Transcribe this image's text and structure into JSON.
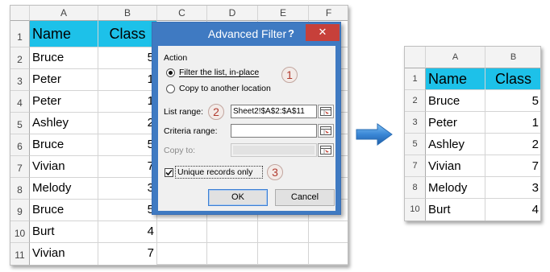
{
  "left_sheet": {
    "columns": [
      "A",
      "B",
      "C",
      "D",
      "E",
      "F"
    ],
    "rows": [
      "1",
      "2",
      "3",
      "4",
      "5",
      "6",
      "7",
      "8",
      "9",
      "10",
      "11"
    ],
    "header": {
      "name": "Name",
      "class": "Class"
    },
    "data": [
      {
        "name": "Bruce",
        "class": "5"
      },
      {
        "name": "Peter",
        "class": "1"
      },
      {
        "name": "Peter",
        "class": "1"
      },
      {
        "name": "Ashley",
        "class": "2"
      },
      {
        "name": "Bruce",
        "class": "5"
      },
      {
        "name": "Vivian",
        "class": "7"
      },
      {
        "name": "Melody",
        "class": "3"
      },
      {
        "name": "Bruce",
        "class": "5"
      },
      {
        "name": "Burt",
        "class": "4"
      },
      {
        "name": "Vivian",
        "class": "7"
      }
    ]
  },
  "dialog": {
    "title": "Advanced Filter",
    "help": "?",
    "close": "✕",
    "action_label": "Action",
    "filter_in_place": "Filter the list, in-place",
    "copy_to_location": "Copy to another location",
    "list_range_label": "List range:",
    "list_range_value": "Sheet2!$A$2:$A$11",
    "criteria_range_label": "Criteria range:",
    "criteria_range_value": "",
    "copy_to_label": "Copy to:",
    "unique_records_label": "Unique records only",
    "unique_records_checked": true,
    "ok_label": "OK",
    "cancel_label": "Cancel",
    "step_badges": [
      "1",
      "2",
      "3"
    ]
  },
  "right_sheet": {
    "columns": [
      "A",
      "B"
    ],
    "rows": [
      "1",
      "2",
      "3",
      "5",
      "7",
      "8",
      "10"
    ],
    "header": {
      "name": "Name",
      "class": "Class"
    },
    "data": [
      {
        "name": "Bruce",
        "class": "5"
      },
      {
        "name": "Peter",
        "class": "1"
      },
      {
        "name": "Ashley",
        "class": "2"
      },
      {
        "name": "Vivian",
        "class": "7"
      },
      {
        "name": "Melody",
        "class": "3"
      },
      {
        "name": "Burt",
        "class": "4"
      }
    ]
  },
  "colors": {
    "header_fill": "#1dc1e9",
    "dialog_frame": "#3f7ac2",
    "close_button": "#c7403a",
    "arrow": "#3a87d6",
    "badge_text": "#b03a2e"
  },
  "icons": {
    "arrow": "right-arrow-icon",
    "range_picker": "range-picker-icon"
  }
}
